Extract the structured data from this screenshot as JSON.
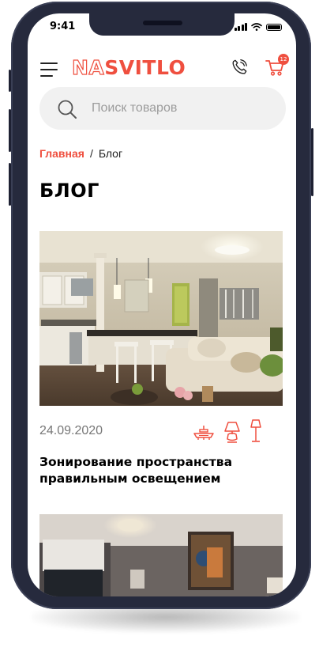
{
  "status_bar": {
    "time": "9:41"
  },
  "header": {
    "logo_prefix": "NA",
    "logo_main": "SVITLO",
    "cart_count": "12"
  },
  "search": {
    "placeholder": "Поиск товаров"
  },
  "breadcrumb": {
    "home": "Главная",
    "separator": "/",
    "current": "Блог"
  },
  "page": {
    "title": "БЛОГ"
  },
  "posts": [
    {
      "date": "24.09.2020",
      "title": "Зонирование пространства правильным освещением",
      "category_icons": [
        "ceiling-lamp-icon",
        "table-lamp-icon",
        "floor-lamp-icon"
      ]
    }
  ],
  "colors": {
    "accent": "#ef4f3f",
    "frame": "#262a3d",
    "search_bg": "#f1f1f1"
  }
}
